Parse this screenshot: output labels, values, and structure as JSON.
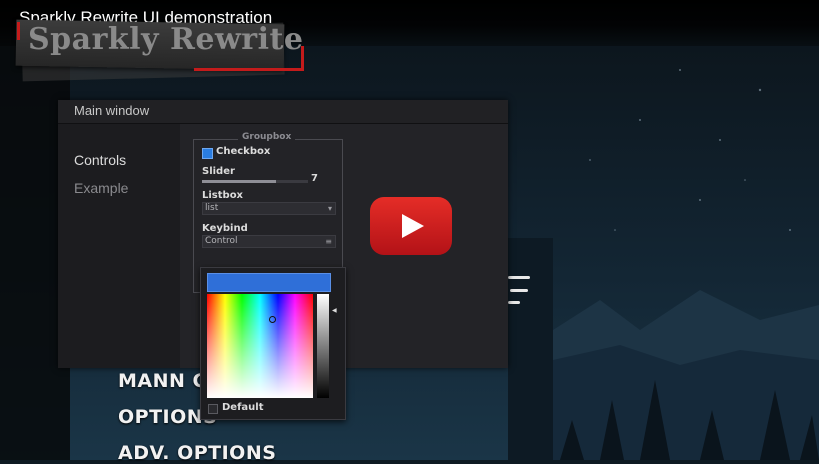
{
  "video": {
    "title": "Sparkly Rewrite UI demonstration"
  },
  "logo": {
    "text": "Sparkly Rewrite"
  },
  "game_menu": {
    "items": [
      "MANN CO",
      "OPTIONS",
      "ADV. OPTIONS"
    ]
  },
  "window": {
    "title": "Main window",
    "sidebar": [
      {
        "label": "Controls",
        "active": true
      },
      {
        "label": "Example",
        "active": false
      }
    ],
    "groupbox": {
      "title": "Groupbox",
      "checkbox_label": "Checkbox",
      "checkbox_checked": true,
      "slider_label": "Slider",
      "slider_value": "7",
      "slider_fraction": 0.7,
      "listbox_label": "Listbox",
      "listbox_value": "list",
      "keybind_label": "Keybind",
      "keybind_value": "Control"
    }
  },
  "color_picker": {
    "selected_color": "#2f6fd8",
    "default_label": "Default",
    "default_checked": false
  },
  "colors": {
    "accent": "#2a7de1",
    "play_button": "#e52d27",
    "logo_red": "#c41b1b"
  },
  "icons": [
    "play-icon",
    "dropdown-arrow-icon",
    "keybind-menu-icon",
    "brightness-arrow-icon"
  ]
}
